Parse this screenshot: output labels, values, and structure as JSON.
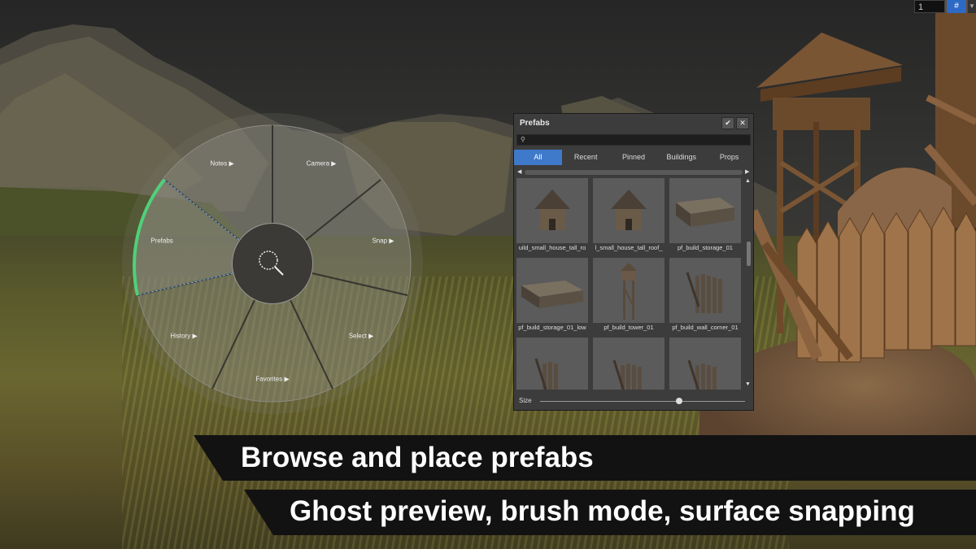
{
  "hud": {
    "layer_value": "1",
    "grid_icon": "grid-snap-icon"
  },
  "radial_menu": {
    "items": [
      {
        "label": "Notes ▶"
      },
      {
        "label": "Camera ▶"
      },
      {
        "label": "Prefabs"
      },
      {
        "label": "Snap ▶"
      },
      {
        "label": "History ▶"
      },
      {
        "label": "Select ▶"
      },
      {
        "label": "Favorites ▶"
      }
    ],
    "active_item": "Prefabs",
    "center_icon": "search-icon",
    "accent_color": "#4fd07a"
  },
  "prefabs_panel": {
    "title": "Prefabs",
    "confirm_icon": "check-icon",
    "close_icon": "close-icon",
    "search_placeholder": "",
    "tabs": [
      {
        "label": "All",
        "active": true
      },
      {
        "label": "Recent",
        "active": false
      },
      {
        "label": "Pinned",
        "active": false
      },
      {
        "label": "Buildings",
        "active": false
      },
      {
        "label": "Props",
        "active": false
      }
    ],
    "items": [
      {
        "label": "uild_small_house_tall_ro",
        "icon": "house-icon"
      },
      {
        "label": "l_small_house_tall_roof_",
        "icon": "house-icon"
      },
      {
        "label": "pf_build_storage_01",
        "icon": "storage-icon"
      },
      {
        "label": "pf_build_storage_01_low",
        "icon": "storage-icon"
      },
      {
        "label": "pf_build_tower_01",
        "icon": "tower-icon"
      },
      {
        "label": "pf_build_wall_corner_01",
        "icon": "wall-icon"
      },
      {
        "label": "",
        "icon": "wall-icon"
      },
      {
        "label": "",
        "icon": "wall-icon"
      },
      {
        "label": "",
        "icon": "wall-icon"
      }
    ],
    "size_label": "Size",
    "size_value": 0.68,
    "active_color": "#3f79c9"
  },
  "captions": {
    "headline": "Browse and place prefabs",
    "subheadline": "Ghost preview, brush mode, surface snapping"
  }
}
